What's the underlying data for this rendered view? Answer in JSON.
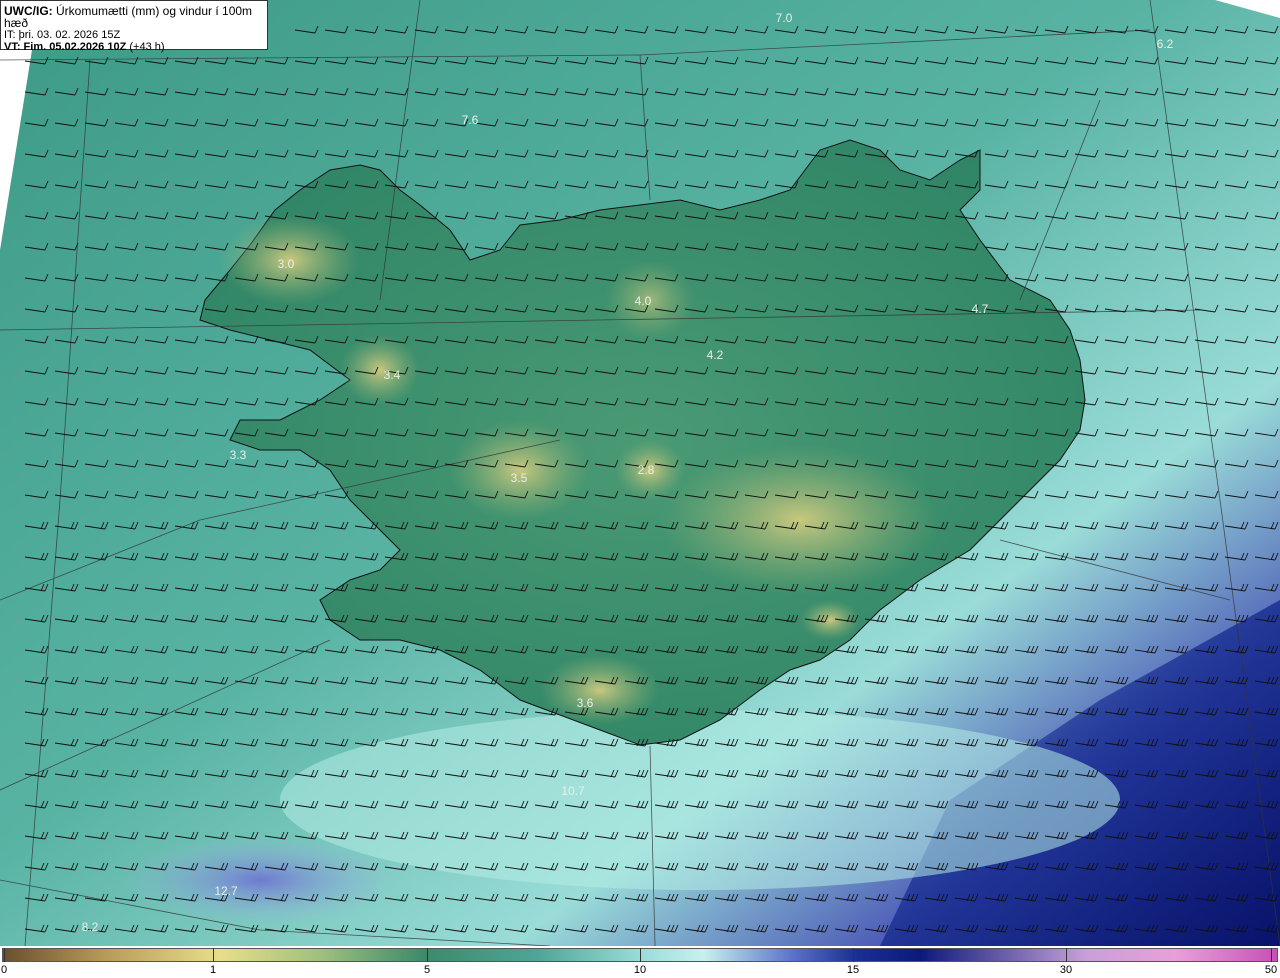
{
  "title": {
    "line1_prefix": "UWC/IG:",
    "line1_text": "Úrkomumætti (mm) og vindur í 100m hæð",
    "line2": "IT: þri. 03. 02. 2026 15Z",
    "line3_prefix": "VT: Fim. 05.02.2026 10Z",
    "line3_suffix": "(+43 h)"
  },
  "colorbar": {
    "ticks": [
      "0",
      "1",
      "5",
      "10",
      "15",
      "30",
      "50"
    ]
  },
  "map_labels": [
    "7.0",
    "6.2",
    "7.6",
    "3.0",
    "4.0",
    "4.7",
    "4.2",
    "3.4",
    "3.3",
    "3.5",
    "2.8",
    "3.6",
    "10.7",
    "12.7",
    "8.2"
  ],
  "colors": {
    "ocean": "#4fa597",
    "land": "#2f8a6e",
    "high_terrain": "#c2c47a",
    "heavy_precip": "#0b2a86"
  }
}
